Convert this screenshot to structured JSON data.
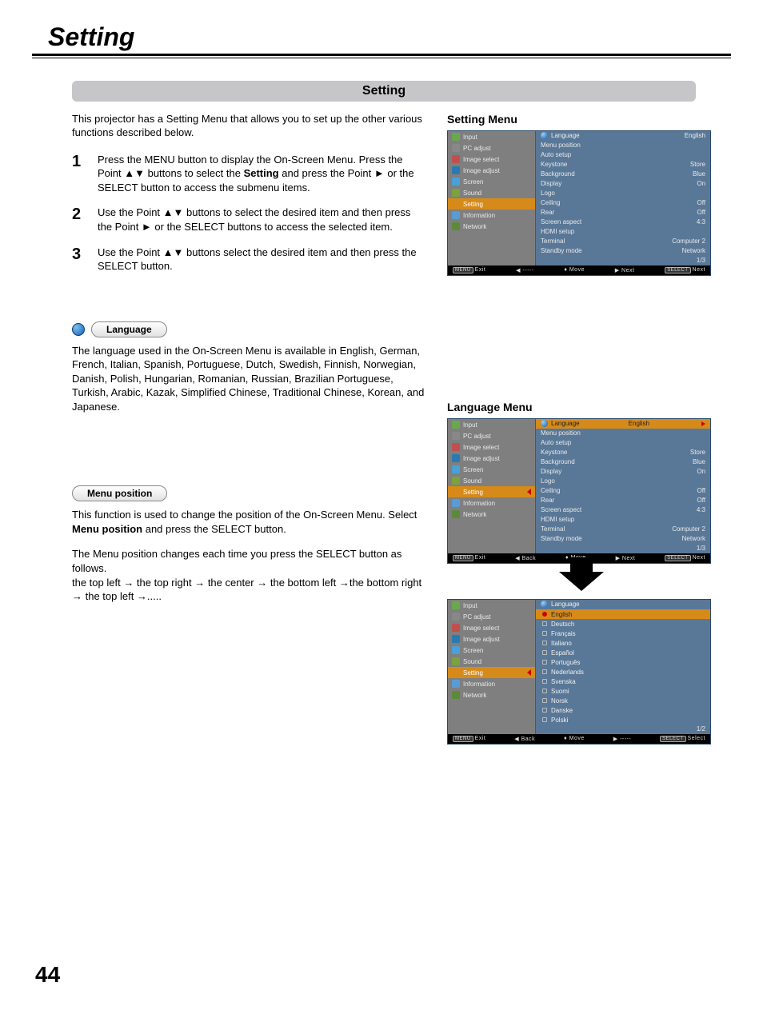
{
  "page_title": "Setting",
  "sub_banner": "Setting",
  "intro": "This projector has a Setting Menu that allows you to set up the other various functions described below.",
  "steps": [
    {
      "num": "1",
      "text_before": "Press the MENU button to display the On-Screen Menu. Press the Point ▲▼ buttons to select the ",
      "bold": "Setting",
      "text_after": " and press the Point ► or the SELECT button to access the submenu items."
    },
    {
      "num": "2",
      "text_before": "Use the Point ▲▼ buttons to select the desired item and then press the Point ► or the SELECT buttons to access the selected item.",
      "bold": "",
      "text_after": ""
    },
    {
      "num": "3",
      "text_before": "Use the Point ▲▼ buttons select the desired item and then press the SELECT button.",
      "bold": "",
      "text_after": ""
    }
  ],
  "language_pill": "Language",
  "language_body": "The language used in the On-Screen Menu is available in English, German, French, Italian, Spanish, Portuguese, Dutch, Swedish, Finnish, Norwegian, Danish, Polish, Hungarian, Romanian, Russian, Brazilian Portuguese, Turkish, Arabic, Kazak, Simplified Chinese, Traditional Chinese, Korean, and Japanese.",
  "menu_position_pill": "Menu position",
  "menu_position_body1_before": "This function is used to change the position of the On-Screen Menu. Select ",
  "menu_position_body1_bold": "Menu position",
  "menu_position_body1_after": " and press the SELECT button.",
  "menu_position_body2": "The Menu position changes each time you press the SELECT button as follows.",
  "menu_position_body3": "the top left  → the top right  → the center  → the bottom left →the bottom right  → the top left  →.....",
  "right_heading1": "Setting Menu",
  "right_heading2": "Language Menu",
  "osd_left_items": [
    {
      "label": "Input",
      "color": "#6aa84f"
    },
    {
      "label": "PC adjust",
      "color": "#888"
    },
    {
      "label": "Image select",
      "color": "#c0504d"
    },
    {
      "label": "Image adjust",
      "color": "#2a7ab0"
    },
    {
      "label": "Screen",
      "color": "#4aa0d8"
    },
    {
      "label": "Sound",
      "color": "#7ba23f"
    },
    {
      "label": "Setting",
      "color": "#d68a1a"
    },
    {
      "label": "Information",
      "color": "#5b9bd5"
    },
    {
      "label": "Network",
      "color": "#5a8a3a"
    }
  ],
  "osd1_right": [
    {
      "label": "Language",
      "value": "English",
      "head": true
    },
    {
      "label": "Menu position",
      "value": ""
    },
    {
      "label": "Auto setup",
      "value": ""
    },
    {
      "label": "Keystone",
      "value": "Store"
    },
    {
      "label": "Background",
      "value": "Blue"
    },
    {
      "label": "Display",
      "value": "On"
    },
    {
      "label": "Logo",
      "value": ""
    },
    {
      "label": "Ceiling",
      "value": "Off"
    },
    {
      "label": "Rear",
      "value": "Off"
    },
    {
      "label": "Screen aspect",
      "value": "4:3"
    },
    {
      "label": "HDMI setup",
      "value": ""
    },
    {
      "label": "Terminal",
      "value": "Computer 2"
    },
    {
      "label": "Standby mode",
      "value": "Network"
    },
    {
      "label": "",
      "value": "1/3"
    }
  ],
  "osd1_bar": {
    "c1": "Exit",
    "c2": "◀ -----",
    "c3": "♦ Move",
    "c4": "▶ Next",
    "c5": "Next"
  },
  "osd2_right": [
    {
      "label": "Language",
      "value": "English",
      "head": true,
      "sel": true
    },
    {
      "label": "Menu position",
      "value": ""
    },
    {
      "label": "Auto setup",
      "value": ""
    },
    {
      "label": "Keystone",
      "value": "Store"
    },
    {
      "label": "Background",
      "value": "Blue"
    },
    {
      "label": "Display",
      "value": "On"
    },
    {
      "label": "Logo",
      "value": ""
    },
    {
      "label": "Ceiling",
      "value": "Off"
    },
    {
      "label": "Rear",
      "value": "Off"
    },
    {
      "label": "Screen aspect",
      "value": "4:3"
    },
    {
      "label": "HDMI setup",
      "value": ""
    },
    {
      "label": "Terminal",
      "value": "Computer 2"
    },
    {
      "label": "Standby mode",
      "value": "Network"
    },
    {
      "label": "",
      "value": "1/3"
    }
  ],
  "osd2_bar": {
    "c1": "Exit",
    "c2": "◀ Back",
    "c3": "♦ Move",
    "c4": "▶ Next",
    "c5": "Next"
  },
  "osd3_langs": [
    {
      "label": "English",
      "sel": true
    },
    {
      "label": "Deutsch"
    },
    {
      "label": "Français"
    },
    {
      "label": "Italiano"
    },
    {
      "label": "Español"
    },
    {
      "label": "Português"
    },
    {
      "label": "Nederlands"
    },
    {
      "label": "Svenska"
    },
    {
      "label": "Suomi"
    },
    {
      "label": "Norsk"
    },
    {
      "label": "Danske"
    },
    {
      "label": "Polski"
    }
  ],
  "osd3_page": "1/2",
  "osd3_head": "Language",
  "osd3_bar": {
    "c1": "Exit",
    "c2": "◀ Back",
    "c3": "♦ Move",
    "c4": "▶ -----",
    "c5": "Select"
  },
  "menu_badge": "MENU",
  "select_badge": "SELECT",
  "page_number": "44"
}
